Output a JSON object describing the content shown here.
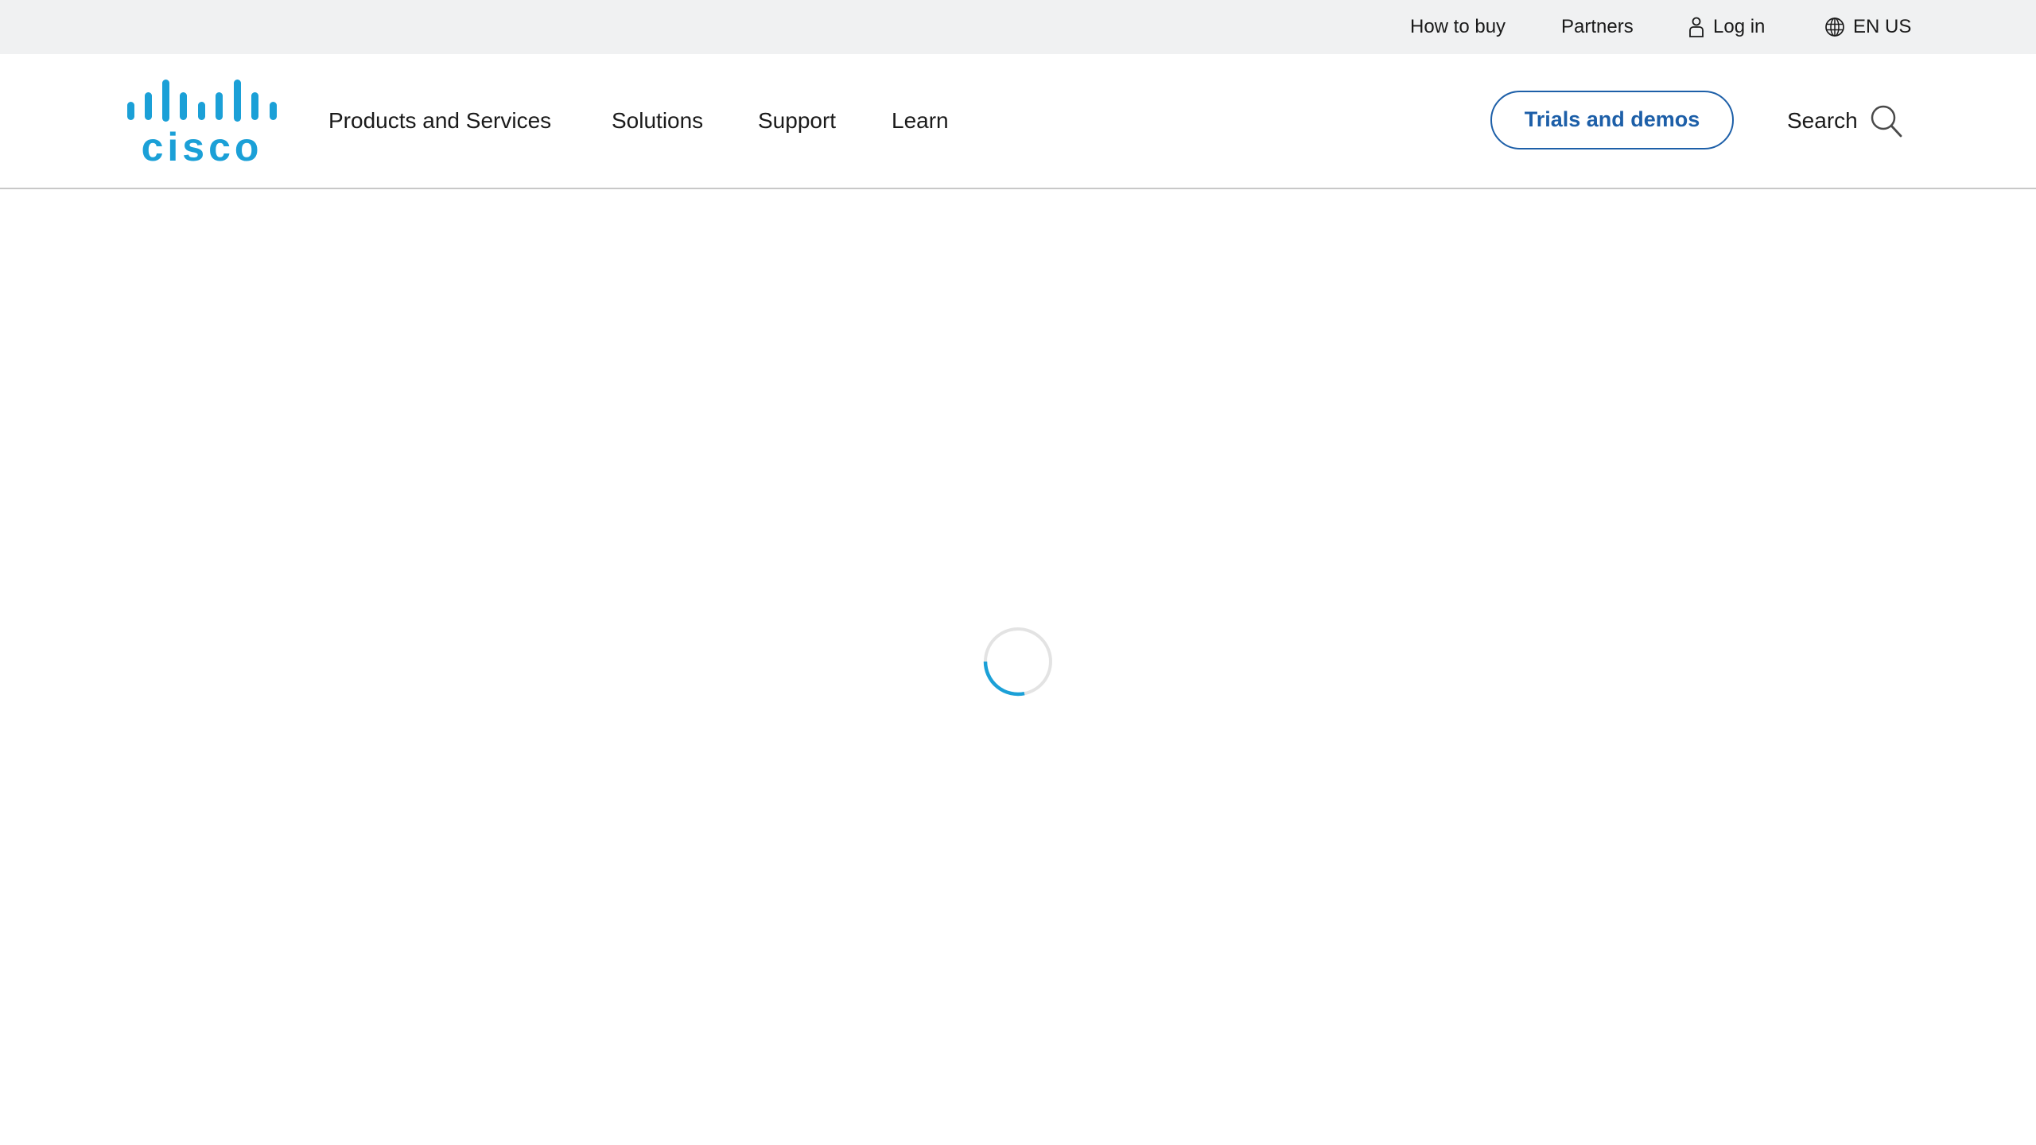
{
  "utility_bar": {
    "how_to_buy": "How to buy",
    "partners": "Partners",
    "log_in": {
      "label": "Log in",
      "icon": "user-icon"
    },
    "locale": {
      "label": "EN US",
      "icon": "globe-icon"
    }
  },
  "header": {
    "logo": {
      "name": "Cisco",
      "wordmark": "cisco",
      "color": "#1ba0d7"
    },
    "nav": [
      {
        "label": "Products and Services"
      },
      {
        "label": "Solutions"
      },
      {
        "label": "Support"
      },
      {
        "label": "Learn"
      }
    ],
    "trials_button": {
      "label": "Trials and demos",
      "color": "#1d5fa8"
    },
    "search": {
      "label": "Search",
      "icon": "search-icon"
    }
  },
  "content": {
    "loading": {
      "state": "loading",
      "icon": "loading-spinner",
      "accent": "#1ba0d7",
      "track": "#e3e3e3"
    }
  }
}
